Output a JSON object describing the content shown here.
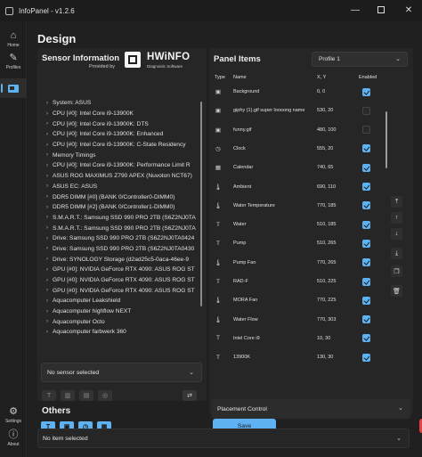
{
  "window": {
    "title": "InfoPanel - v1.2.6",
    "minimize": "—",
    "maximize": "",
    "close": "✕"
  },
  "nav": {
    "home": {
      "label": "Home",
      "icon": "home-icon"
    },
    "profiles": {
      "label": "Profiles",
      "icon": "profiles-icon"
    },
    "design": {
      "icon": "design-icon"
    },
    "settings": {
      "label": "Settings",
      "icon": "gear-icon"
    },
    "about": {
      "label": "About",
      "icon": "info-icon"
    }
  },
  "page": {
    "title": "Design"
  },
  "sensor": {
    "title": "Sensor Information",
    "provided_by": "Provided by",
    "brand": "HWiNFO",
    "brand_sub": "Diagnostic Software",
    "tree": [
      "System: ASUS",
      "CPU [#0]: Intel Core i9-13900K",
      "CPU [#0]: Intel Core i9-13900K: DTS",
      "CPU [#0]: Intel Core i9-13900K: Enhanced",
      "CPU [#0]: Intel Core i9-13900K: C-State Residency",
      "Memory Timings",
      "CPU [#0]: Intel Core i9-13900K: Performance Limit R",
      "ASUS ROG MAXIMUS Z790 APEX (Nuvoton NCT67)",
      "ASUS EC: ASUS",
      "DDR5 DIMM [#0] (BANK 0/Controller0-DIMM0)",
      "DDR5 DIMM [#2] (BANK 0/Controller1-DIMM0)",
      "S.M.A.R.T.: Samsung SSD 990 PRO 2TB (S6Z2NJ0TA",
      "S.M.A.R.T.: Samsung SSD 990 PRO 2TB (S6Z2NJ0TA",
      "Drive: Samsung SSD 990 PRO 2TB (S6Z2NJ0TA0424",
      "Drive: Samsung SSD 990 PRO 2TB (S6Z2NJ0TA0430",
      "Drive: SYNOLOGY Storage (d2ad25c5-0aca-46ee-9",
      "GPU [#0]: NVIDIA GeForce RTX 4090: ASUS ROG ST",
      "GPU [#0]: NVIDIA GeForce RTX 4090: ASUS ROG ST",
      "GPU [#0]: NVIDIA GeForce RTX 4090: ASUS ROG ST",
      "Aquacomputer Leakshield",
      "Aquacomputer highflow NEXT",
      "Aquacomputer Octo",
      "Aquacomputer farbwerk 360"
    ],
    "selected": "No sensor selected"
  },
  "others": {
    "title": "Others"
  },
  "panel_items": {
    "title": "Panel Items",
    "profile": "Profile 1",
    "columns": {
      "type": "Type",
      "name": "Name",
      "xy": "X, Y",
      "enabled": "Enabled"
    },
    "rows": [
      {
        "icon": "image-icon",
        "name": "Background",
        "xy": "0, 0",
        "enabled": true
      },
      {
        "icon": "image-icon",
        "name": "giphy (1).gif super loooong name",
        "xy": "530, 20",
        "enabled": false
      },
      {
        "icon": "image-icon",
        "name": "funny.gif",
        "xy": "480, 100",
        "enabled": false
      },
      {
        "icon": "clock-icon",
        "name": "Clock",
        "xy": "555, 20",
        "enabled": true
      },
      {
        "icon": "calendar-icon",
        "name": "Calendar",
        "xy": "740, 65",
        "enabled": true
      },
      {
        "icon": "thermometer-icon",
        "name": "Ambient",
        "xy": "690, 110",
        "enabled": true
      },
      {
        "icon": "thermometer-icon",
        "name": "Water Temperature",
        "xy": "770, 185",
        "enabled": true
      },
      {
        "icon": "text-icon",
        "name": "Water",
        "xy": "510, 185",
        "enabled": true
      },
      {
        "icon": "text-icon",
        "name": "Pump",
        "xy": "510, 265",
        "enabled": true
      },
      {
        "icon": "thermometer-icon",
        "name": "Pump Fan",
        "xy": "770, 265",
        "enabled": true
      },
      {
        "icon": "text-icon",
        "name": "RAD-F",
        "xy": "510, 225",
        "enabled": true
      },
      {
        "icon": "thermometer-icon",
        "name": "MORA Fan",
        "xy": "770, 225",
        "enabled": true
      },
      {
        "icon": "thermometer-icon",
        "name": "Water Flow",
        "xy": "770, 303",
        "enabled": true
      },
      {
        "icon": "text-icon",
        "name": "Intel Core i9",
        "xy": "10, 30",
        "enabled": true
      },
      {
        "icon": "text-icon",
        "name": "13900K",
        "xy": "130, 30",
        "enabled": true
      }
    ],
    "placement": "Placement Control",
    "save": "Save"
  },
  "bottom": {
    "selected": "No item selected"
  },
  "colors": {
    "accent": "#5fb2f2",
    "danger": "#e64040",
    "bg": "#202020",
    "panel": "#262626"
  }
}
